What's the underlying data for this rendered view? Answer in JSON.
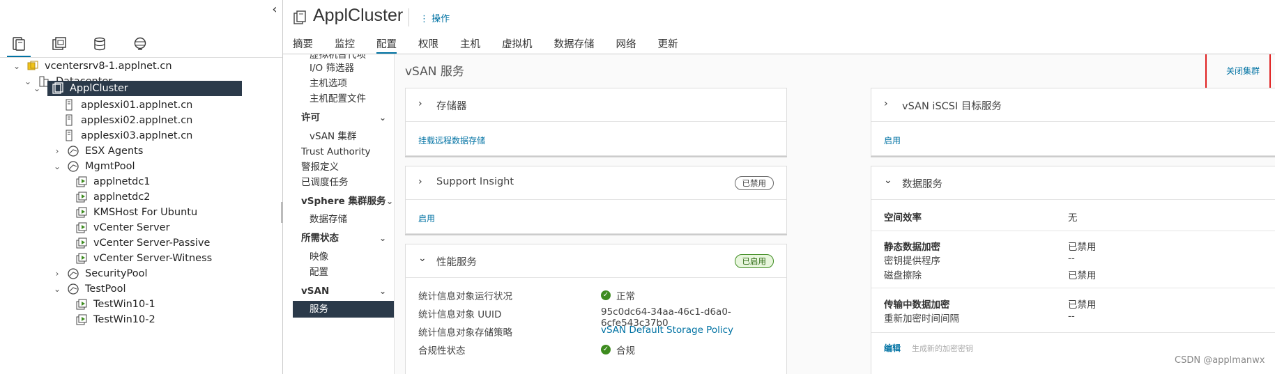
{
  "nav": {
    "collapse_glyph": "‹",
    "icon_tabs": [
      "hosts-clusters-icon",
      "vms-templates-icon",
      "storage-icon",
      "networking-icon"
    ],
    "tree": [
      {
        "label": "vcentersrv8-1.applnet.cn",
        "toggle": "⌄",
        "icon": "vcenter-icon"
      },
      {
        "label": "Datacenter",
        "toggle": "⌄",
        "icon": "datacenter-icon"
      },
      {
        "label": "ApplCluster",
        "toggle": "⌄",
        "icon": "cluster-icon"
      },
      {
        "label": "applesxi01.applnet.cn",
        "toggle": "",
        "icon": "host-icon"
      },
      {
        "label": "applesxi02.applnet.cn",
        "toggle": "",
        "icon": "host-icon"
      },
      {
        "label": "applesxi03.applnet.cn",
        "toggle": "",
        "icon": "host-icon"
      },
      {
        "label": "ESX Agents",
        "toggle": "›",
        "icon": "resource-pool-icon"
      },
      {
        "label": "MgmtPool",
        "toggle": "⌄",
        "icon": "resource-pool-icon"
      },
      {
        "label": "applnetdc1",
        "toggle": "",
        "icon": "vm-icon"
      },
      {
        "label": "applnetdc2",
        "toggle": "",
        "icon": "vm-icon"
      },
      {
        "label": "KMSHost For Ubuntu",
        "toggle": "",
        "icon": "vm-icon"
      },
      {
        "label": "vCenter Server",
        "toggle": "",
        "icon": "vm-icon"
      },
      {
        "label": "vCenter Server-Passive",
        "toggle": "",
        "icon": "vm-icon"
      },
      {
        "label": "vCenter Server-Witness",
        "toggle": "",
        "icon": "vm-icon"
      },
      {
        "label": "SecurityPool",
        "toggle": "›",
        "icon": "resource-pool-icon"
      },
      {
        "label": "TestPool",
        "toggle": "⌄",
        "icon": "resource-pool-icon"
      },
      {
        "label": "TestWin10-1",
        "toggle": "",
        "icon": "vm-icon"
      },
      {
        "label": "TestWin10-2",
        "toggle": "",
        "icon": "vm-icon"
      }
    ]
  },
  "header": {
    "title": "ApplCluster",
    "actions_label": "⋮ 操作",
    "tabs": [
      "摘要",
      "监控",
      "配置",
      "权限",
      "主机",
      "虚拟机",
      "数据存储",
      "网络",
      "更新"
    ],
    "active_tab": "配置"
  },
  "submenu": {
    "items": [
      {
        "label": "虚拟机替代项",
        "kind": "sub"
      },
      {
        "label": "I/O 筛选器",
        "kind": "sub"
      },
      {
        "label": "主机选项",
        "kind": "sub"
      },
      {
        "label": "主机配置文件",
        "kind": "sub"
      },
      {
        "label": "许可",
        "kind": "head",
        "chev": "⌄"
      },
      {
        "label": "vSAN 集群",
        "kind": "sub"
      },
      {
        "label": "Trust Authority",
        "kind": "top"
      },
      {
        "label": "警报定义",
        "kind": "top"
      },
      {
        "label": "已调度任务",
        "kind": "top"
      },
      {
        "label": "vSphere 集群服务",
        "kind": "head",
        "chev": "⌄"
      },
      {
        "label": "数据存储",
        "kind": "sub"
      },
      {
        "label": "所需状态",
        "kind": "head",
        "chev": "⌄"
      },
      {
        "label": "映像",
        "kind": "sub"
      },
      {
        "label": "配置",
        "kind": "sub"
      },
      {
        "label": "vSAN",
        "kind": "head",
        "chev": "⌄"
      },
      {
        "label": "服务",
        "kind": "active"
      }
    ]
  },
  "main": {
    "title": "vSAN 服务",
    "shutdown_link": "关闭集群",
    "storage_card": {
      "title": "存储器",
      "link": "挂载远程数据存储"
    },
    "support_card": {
      "title": "Support Insight",
      "badge": "已禁用",
      "link": "启用"
    },
    "perf_card": {
      "title": "性能服务",
      "badge": "已启用",
      "rows": [
        {
          "key": "统计信息对象运行状况",
          "value": "正常",
          "status": "ok"
        },
        {
          "key": "统计信息对象 UUID",
          "value": "95c0dc64-34aa-46c1-d6a0-6cfe543c37b0"
        },
        {
          "key": "统计信息对象存储策略",
          "value": "vSAN Default Storage Policy",
          "link": true
        },
        {
          "key": "合规性状态",
          "value": "合规",
          "status": "ok"
        }
      ]
    },
    "iscsi_card": {
      "title": "vSAN iSCSI 目标服务",
      "link": "启用"
    },
    "data_card": {
      "title": "数据服务",
      "rows": [
        {
          "key": "空间效率",
          "value": "无",
          "bold": true
        },
        {
          "key": "静态数据加密",
          "value": "已禁用",
          "bold": true
        },
        {
          "key": "密钥提供程序",
          "value": "--"
        },
        {
          "key": "磁盘擦除",
          "value": "已禁用"
        },
        {
          "key": "传输中数据加密",
          "value": "已禁用",
          "bold": true
        },
        {
          "key": "重新加密时间间隔",
          "value": "--"
        }
      ],
      "edit_link": "编辑",
      "rekey_link": "生成新的加密密钥"
    }
  },
  "watermark": "CSDN @applmanwx",
  "colors": {
    "accent": "#0072a3",
    "selected_bg": "#2b3a4a",
    "enabled_badge": "#3d8b1f",
    "highlight_box": "#e02020"
  }
}
